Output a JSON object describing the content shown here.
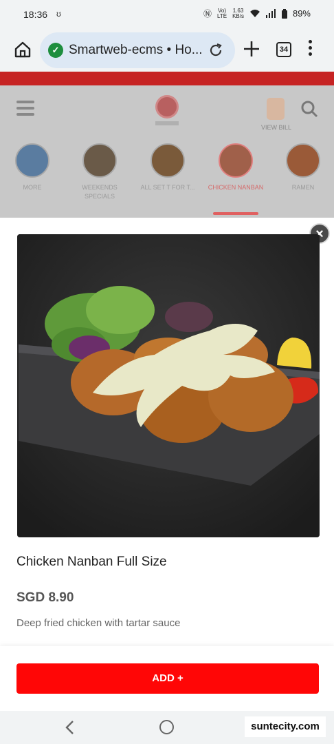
{
  "status_bar": {
    "time": "18:36",
    "net_speed_value": "1.63",
    "net_speed_unit": "KB/s",
    "network_type_top": "Vo)",
    "network_type_bottom": "LTE",
    "battery": "89%"
  },
  "browser": {
    "url_text": "Smartweb-ecms • Ho...",
    "tab_count": "34"
  },
  "site": {
    "bill_label": "VIEW BILL",
    "categories": [
      {
        "label": "MORE"
      },
      {
        "label": "WEEKENDS SPECIALS"
      },
      {
        "label": "ALL SET T FOR T..."
      },
      {
        "label": "CHICKEN NANBAN"
      },
      {
        "label": "RAMEN"
      }
    ]
  },
  "item": {
    "name": "Chicken Nanban Full Size",
    "price": "SGD 8.90",
    "description": "Deep fried chicken with tartar sauce",
    "add_label": "ADD"
  },
  "watermark": "suntecity.com",
  "colors": {
    "add_button": "#ff0606",
    "brand_red": "#c62323"
  }
}
